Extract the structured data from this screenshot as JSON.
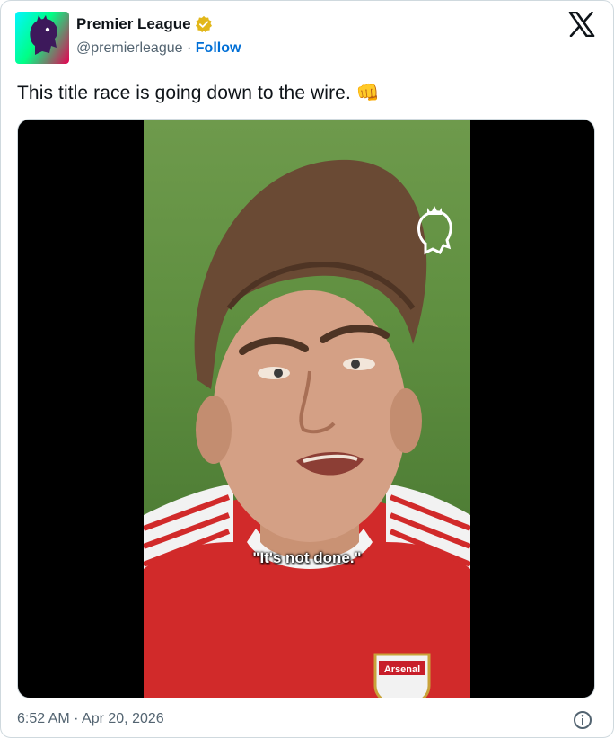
{
  "account": {
    "display_name": "Premier League",
    "handle": "@premierleague",
    "separator": "·",
    "follow_label": "Follow",
    "verified_badge": "gold-check-icon"
  },
  "tweet": {
    "text": "This title race is going down to the wire. 👊"
  },
  "media": {
    "subtitle": "\"It's not done.\"",
    "crest_text": "Arsenal",
    "watermark": "premier-league-lion-icon"
  },
  "footer": {
    "timestamp": "6:52 AM · Apr 20, 2026",
    "info_icon": "info-icon"
  },
  "colors": {
    "follow": "#006fd6",
    "secondary_text": "#536471",
    "verified_gold": "#e2b719",
    "pl_purple": "#3d195b"
  }
}
